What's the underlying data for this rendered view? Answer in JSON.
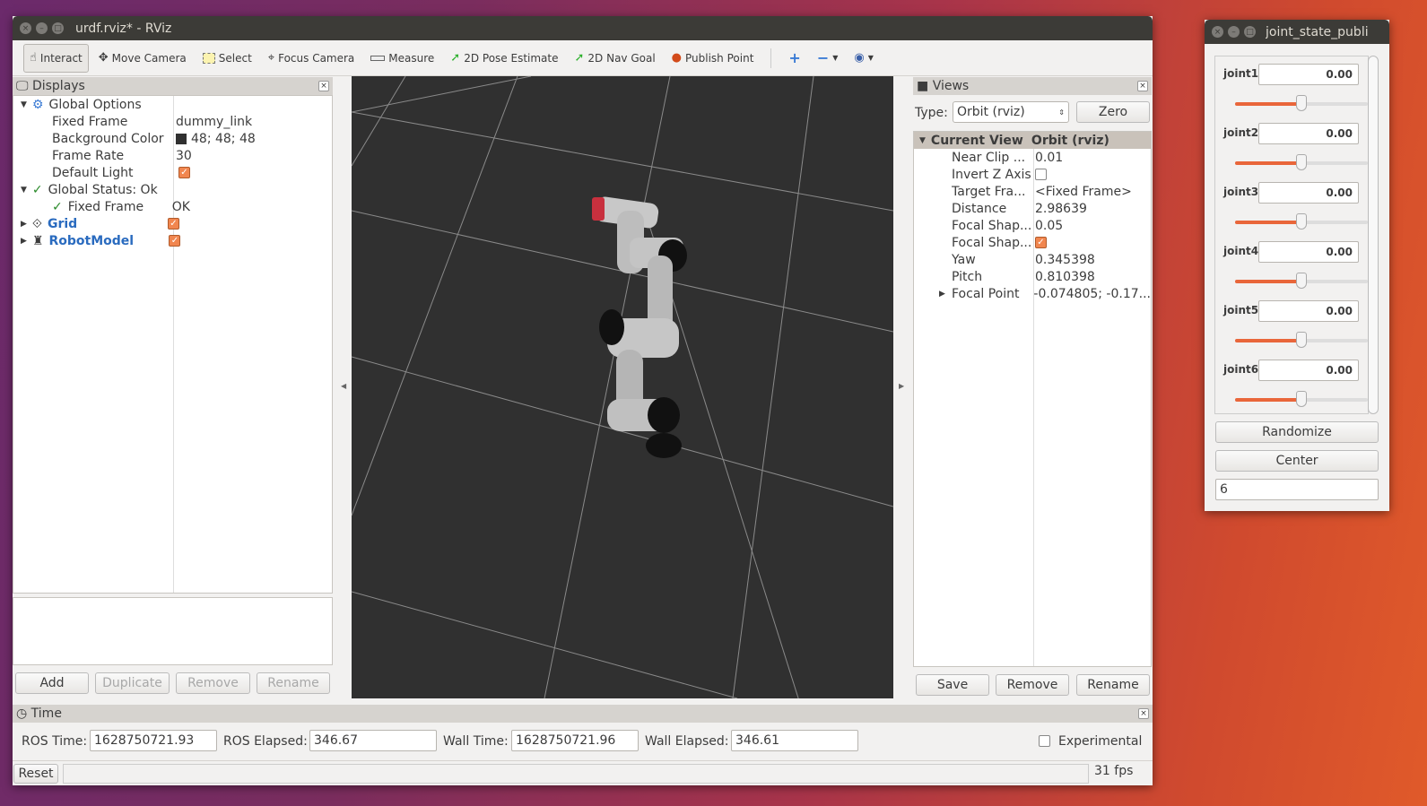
{
  "rviz": {
    "title": "urdf.rviz* - RViz",
    "toolbar": [
      {
        "label": "Interact",
        "icon": "hand-icon"
      },
      {
        "label": "Move Camera",
        "icon": "move-camera-icon"
      },
      {
        "label": "Select",
        "icon": "select-box-icon"
      },
      {
        "label": "Focus Camera",
        "icon": "focus-camera-icon"
      },
      {
        "label": "Measure",
        "icon": "ruler-icon"
      },
      {
        "label": "2D Pose Estimate",
        "icon": "green-arrow-icon"
      },
      {
        "label": "2D Nav Goal",
        "icon": "green-arrow-icon"
      },
      {
        "label": "Publish Point",
        "icon": "map-pin-icon"
      }
    ],
    "displays": {
      "title": "Displays",
      "global_options": "Global Options",
      "fixed_frame_label": "Fixed Frame",
      "fixed_frame": "dummy_link",
      "bg_label": "Background Color",
      "bg": "48; 48; 48",
      "bg_color": "#303030",
      "frame_rate_label": "Frame Rate",
      "frame_rate": "30",
      "default_light_label": "Default Light",
      "global_status": "Global Status: Ok",
      "status_fixed_frame": "Fixed Frame",
      "status_value": "OK",
      "grid": "Grid",
      "robot_model": "RobotModel",
      "buttons": {
        "add": "Add",
        "duplicate": "Duplicate",
        "remove": "Remove",
        "rename": "Rename"
      }
    },
    "views": {
      "title": "Views",
      "type_label": "Type:",
      "type_value": "Orbit (rviz)",
      "zero": "Zero",
      "header": [
        "Current View",
        "Orbit (rviz)"
      ],
      "rows": [
        [
          "Near Clip ...",
          "0.01"
        ],
        [
          "Invert Z Axis",
          ""
        ],
        [
          "Target Fra...",
          "<Fixed Frame>"
        ],
        [
          "Distance",
          "2.98639"
        ],
        [
          "Focal Shap...",
          "0.05"
        ],
        [
          "Focal Shap...",
          ""
        ],
        [
          "Yaw",
          "0.345398"
        ],
        [
          "Pitch",
          "0.810398"
        ],
        [
          "Focal Point",
          "-0.074805; -0.17..."
        ]
      ],
      "buttons": {
        "save": "Save",
        "remove": "Remove",
        "rename": "Rename"
      }
    },
    "time": {
      "title": "Time",
      "ros_time_label": "ROS Time:",
      "ros_time": "1628750721.93",
      "ros_elapsed_label": "ROS Elapsed:",
      "ros_elapsed": "346.67",
      "wall_time_label": "Wall Time:",
      "wall_time": "1628750721.96",
      "wall_elapsed_label": "Wall Elapsed:",
      "wall_elapsed": "346.61",
      "experimental": "Experimental"
    },
    "status": {
      "reset": "Reset",
      "fps": "31 fps"
    }
  },
  "jsp": {
    "title": "joint_state_publi",
    "joints": [
      {
        "name": "joint1",
        "value": "0.00",
        "slider": 0.5
      },
      {
        "name": "joint2",
        "value": "0.00",
        "slider": 0.5
      },
      {
        "name": "joint3",
        "value": "0.00",
        "slider": 0.5
      },
      {
        "name": "joint4",
        "value": "0.00",
        "slider": 0.5
      },
      {
        "name": "joint5",
        "value": "0.00",
        "slider": 0.5
      },
      {
        "name": "joint6",
        "value": "0.00",
        "slider": 0.5
      }
    ],
    "randomize": "Randomize",
    "center": "Center",
    "count": "6"
  }
}
